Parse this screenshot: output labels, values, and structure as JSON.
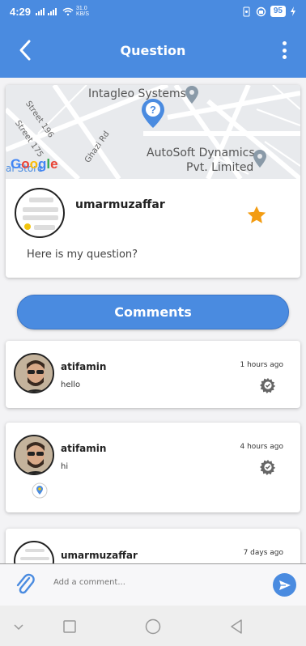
{
  "status_bar": {
    "time": "4:29",
    "net_speed_value": "31.0",
    "net_speed_unit": "KB/S",
    "battery": "95"
  },
  "app_bar": {
    "title": "Question"
  },
  "map": {
    "place_1": "Intagleo Systems",
    "place_2_line1": "AutoSoft Dynamics",
    "place_2_line2": "Pvt. Limited",
    "street_1": "Street 196",
    "street_2": "Street 175",
    "street_3": "Ghazi Rd",
    "partial_label": "al Store",
    "logo": "Google"
  },
  "question": {
    "username": "umarmuzaffar",
    "text": "Here is my question?",
    "starred": true
  },
  "comments_button_label": "Comments",
  "comments": [
    {
      "username": "atifamin",
      "message": "hello",
      "time": "1 hours ago"
    },
    {
      "username": "atifamin",
      "message": "hi",
      "time": "4 hours ago"
    },
    {
      "username": "umarmuzaffar",
      "message": "",
      "time": "7 days ago"
    }
  ],
  "composer": {
    "placeholder": "Add a comment..."
  },
  "colors": {
    "primary": "#4a8be0",
    "star": "#f39c12",
    "pin": "#4a8be0"
  }
}
